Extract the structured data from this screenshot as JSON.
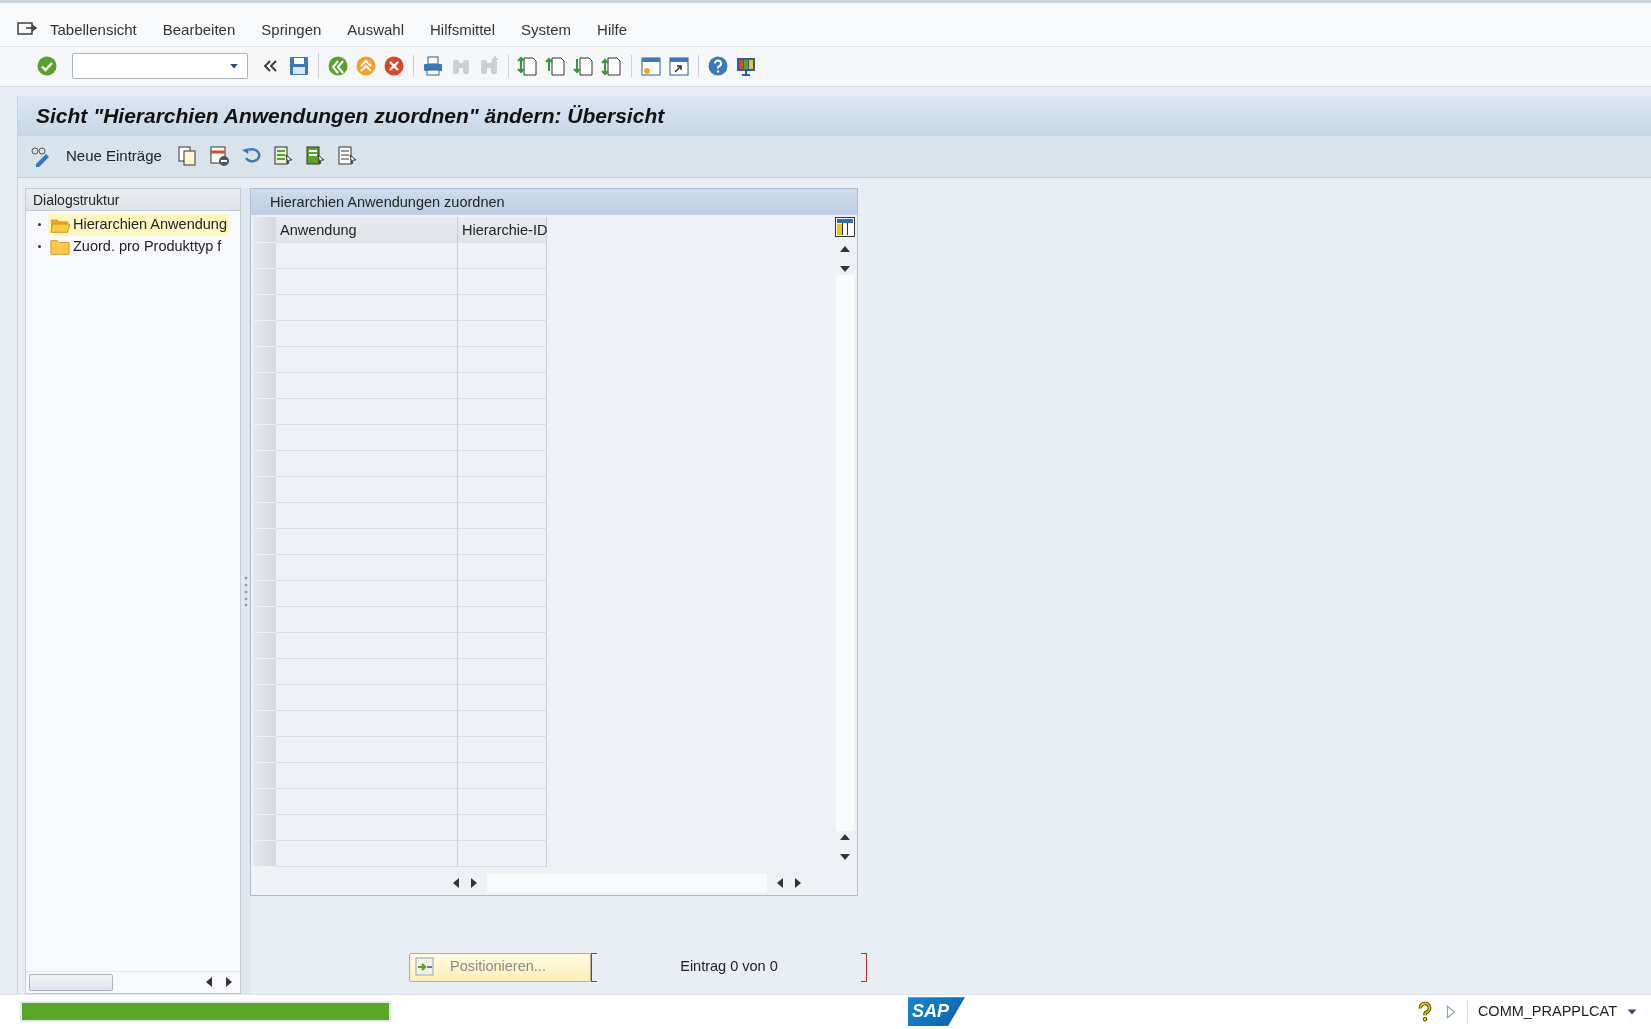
{
  "menu": [
    {
      "label": "Tabellensicht"
    },
    {
      "label": "Bearbeiten"
    },
    {
      "label": "Springen"
    },
    {
      "label": "Auswahl"
    },
    {
      "label": "Hilfsmittel"
    },
    {
      "label": "System"
    },
    {
      "label": "Hilfe"
    }
  ],
  "toolbar": {
    "groups": [
      [
        {
          "kind": "enter",
          "disabled": false
        },
        {
          "kind": "command_field",
          "disabled": false
        },
        {
          "kind": "collapse",
          "disabled": false
        },
        {
          "kind": "save",
          "disabled": false
        }
      ],
      [
        {
          "kind": "back",
          "disabled": false
        },
        {
          "kind": "exit",
          "disabled": false
        },
        {
          "kind": "cancel",
          "disabled": false
        }
      ],
      [
        {
          "kind": "print",
          "disabled": false
        },
        {
          "kind": "find",
          "disabled": true
        },
        {
          "kind": "find_next",
          "disabled": true
        }
      ],
      [
        {
          "kind": "first_page",
          "disabled": false
        },
        {
          "kind": "previous_page",
          "disabled": false
        },
        {
          "kind": "next_page",
          "disabled": false
        },
        {
          "kind": "last_page",
          "disabled": false
        }
      ],
      [
        {
          "kind": "new_session",
          "disabled": false
        },
        {
          "kind": "shortcut",
          "disabled": false
        }
      ],
      [
        {
          "kind": "help",
          "disabled": false
        },
        {
          "kind": "customize",
          "disabled": false
        }
      ]
    ]
  },
  "title": "Sicht \"Hierarchien Anwendungen zuordnen\" ändern: Übersicht",
  "app_toolbar": [
    {
      "kind": "display_change"
    },
    {
      "kind": "text",
      "label": "Neue Einträge"
    },
    {
      "kind": "copy"
    },
    {
      "kind": "delete"
    },
    {
      "kind": "undo"
    },
    {
      "kind": "select_all"
    },
    {
      "kind": "select_block"
    },
    {
      "kind": "deselect_all"
    }
  ],
  "dialog_structure": {
    "title": "Dialogstruktur",
    "items": [
      {
        "label": "Hierarchien Anwendung",
        "selected": true
      },
      {
        "label": "Zuord. pro Produkttyp f",
        "selected": false
      }
    ]
  },
  "table": {
    "title": "Hierarchien Anwendungen zuordnen",
    "columns": [
      "Anwendung",
      "Hierarchie-ID"
    ]
  },
  "position_button": {
    "label": "Positionieren..."
  },
  "entry_info": "Eintrag 0 von 0",
  "status_bar": {
    "logo": "SAP",
    "system": "COMM_PRAPPLCAT"
  }
}
